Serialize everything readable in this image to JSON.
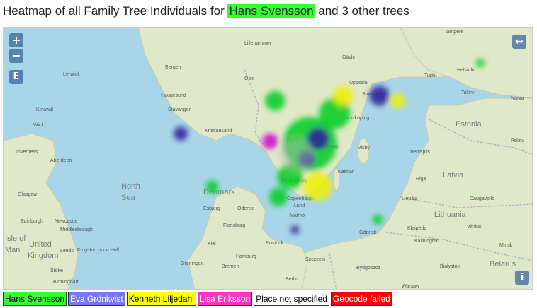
{
  "header": {
    "title_prefix": "Heatmap of all Family Tree Individuals for ",
    "title_highlight": "Hans Svensson",
    "title_suffix": " and 3 other trees",
    "highlight_color": "#33ff33"
  },
  "map": {
    "controls": {
      "zoom_in": "+",
      "zoom_out": "−",
      "layer_button": "E",
      "fullscreen": "↔",
      "info": "i"
    },
    "place_labels": [
      "Tampere",
      "Lillehammer",
      "Gävle",
      "Helsinki",
      "Bergen",
      "Oslo",
      "Uppsala",
      "Stockholm",
      "Tallinn",
      "Lerwick",
      "Haugesund",
      "Stavanger",
      "Narva",
      "Kirkwall",
      "Wick",
      "Kristiansand",
      "Estonia",
      "Pskov",
      "Inverness",
      "Aberdeen",
      "Visby",
      "Ventspils",
      "Latvia",
      "Glasgow",
      "North",
      "Sea",
      "Denmark",
      "Riga",
      "Esbjerg",
      "Odense",
      "Liepāja",
      "Daugavpils",
      "Edinburgh",
      "Newcastle",
      "Middlesbrough",
      "Klaipėda",
      "Lithuania",
      "Kaliningrad",
      "Vilnius",
      "Flensburg",
      "Kiel",
      "Gdansk",
      "Minsk",
      "United",
      "Kingdom",
      "Man",
      "Isle of",
      "Leeds",
      "Kingston upon Hull",
      "Rostock",
      "Hamburg",
      "Szczecin",
      "Białystok",
      "Bremen",
      "Groningen",
      "Bydgoszcz",
      "Stoke",
      "Birmingham",
      "Berlin",
      "Warsaw",
      "Belarus",
      "Helsingborg",
      "Copenhagen",
      "Lund",
      "Malmö",
      "Borås",
      "Jönköping",
      "Kalmar",
      "Turku",
      "Norrköping"
    ],
    "tile_colors": {
      "water": "#a8d6e8",
      "land": "#dfe8c8",
      "border": "#b8a0c8"
    },
    "heat_spots": [
      {
        "series": "hans",
        "lon": 14.5,
        "lat": 57.4,
        "r": 38
      },
      {
        "series": "hans",
        "lon": 12.4,
        "lat": 59.1,
        "r": 14
      },
      {
        "series": "hans",
        "lon": 16.0,
        "lat": 58.6,
        "r": 22
      },
      {
        "series": "hans",
        "lon": 13.3,
        "lat": 56.1,
        "r": 18
      },
      {
        "series": "hans",
        "lon": 12.6,
        "lat": 55.3,
        "r": 13
      },
      {
        "series": "hans",
        "lon": 8.6,
        "lat": 55.7,
        "r": 9
      },
      {
        "series": "hans",
        "lon": 18.6,
        "lat": 54.4,
        "r": 7
      },
      {
        "series": "hans",
        "lon": 24.8,
        "lat": 60.6,
        "r": 6
      },
      {
        "series": "eva",
        "lon": 15.0,
        "lat": 57.6,
        "r": 16
      },
      {
        "series": "eva",
        "lon": 14.3,
        "lat": 56.8,
        "r": 12
      },
      {
        "series": "eva",
        "lon": 18.7,
        "lat": 59.3,
        "r": 14
      },
      {
        "series": "eva",
        "lon": 6.7,
        "lat": 57.8,
        "r": 10
      },
      {
        "series": "eva",
        "lon": 13.6,
        "lat": 54.0,
        "r": 6
      },
      {
        "series": "kenneth",
        "lon": 16.5,
        "lat": 59.3,
        "r": 14
      },
      {
        "series": "kenneth",
        "lon": 15.0,
        "lat": 55.7,
        "r": 20
      },
      {
        "series": "kenneth",
        "lon": 19.8,
        "lat": 59.1,
        "r": 11
      },
      {
        "series": "lisa",
        "lon": 12.1,
        "lat": 57.5,
        "r": 11
      },
      {
        "series": "notspec",
        "lon": 13.7,
        "lat": 57.0,
        "r": 24
      }
    ]
  },
  "legend": [
    {
      "key": "hans",
      "label": "Hans Svensson",
      "color": "#33ff33",
      "text_color": "#000000"
    },
    {
      "key": "eva",
      "label": "Eva Grönkvist",
      "color": "#7777ff",
      "text_color": "#ffffff"
    },
    {
      "key": "kenneth",
      "label": "Kenneth Liljedahl",
      "color": "#ffff00",
      "text_color": "#000000"
    },
    {
      "key": "lisa",
      "label": "Lisa Eriksson",
      "color": "#ff33cc",
      "text_color": "#ffffff"
    },
    {
      "key": "notspec",
      "label": "Place not specified",
      "color": "#ffffff",
      "text_color": "#000000"
    },
    {
      "key": "geofail",
      "label": "Geocode failed",
      "color": "#ff0000",
      "text_color": "#ffffff"
    }
  ],
  "series_colors": {
    "hans": "#00cc22",
    "eva": "#2a1a9a",
    "kenneth": "#f0f000",
    "lisa": "#cc00cc",
    "notspec": "#b8b8b8"
  }
}
